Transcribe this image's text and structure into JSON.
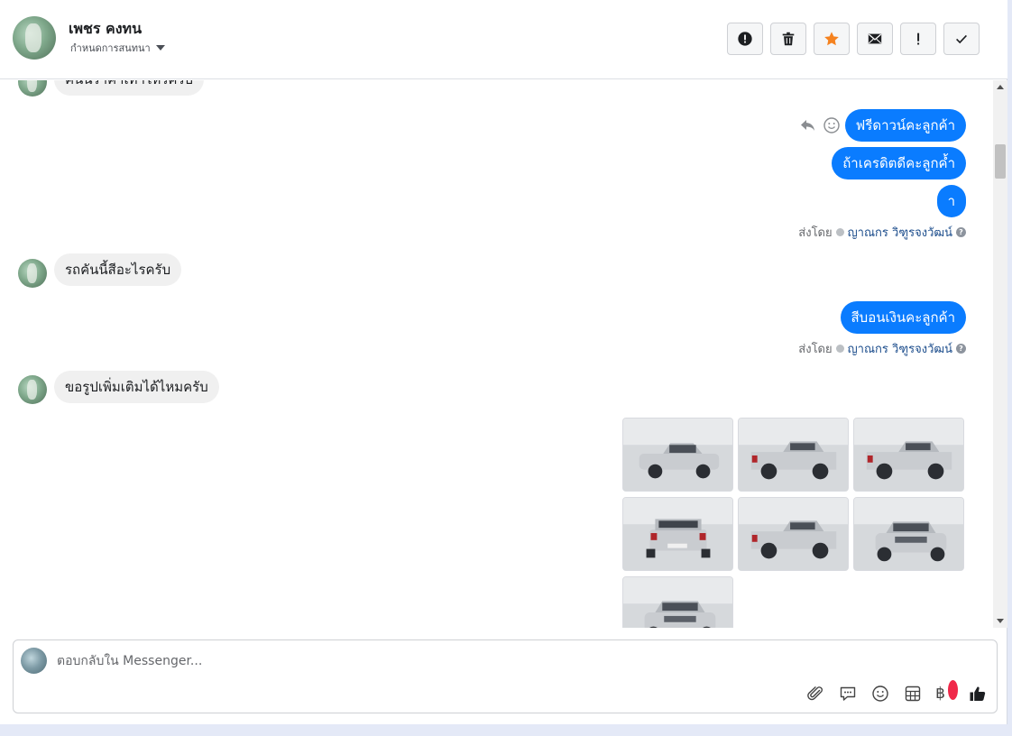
{
  "header": {
    "contact_name": "เพชร คงทน",
    "assign_label": "กำหนดการสนทนา",
    "tools": [
      {
        "name": "spam-button",
        "icon": "alert-circle-icon"
      },
      {
        "name": "delete-button",
        "icon": "trash-icon"
      },
      {
        "name": "star-button",
        "icon": "star-icon"
      },
      {
        "name": "mark-unread-button",
        "icon": "envelope-icon"
      },
      {
        "name": "follow-up-button",
        "icon": "exclamation-icon"
      },
      {
        "name": "done-button",
        "icon": "check-icon"
      }
    ],
    "accent_star_color": "#f5821f"
  },
  "thread": {
    "cut_message": "คันนี้ราคาเท่าไหร่ครับ",
    "messages_out_1": [
      "ฟรีดาวน์คะลูกค้า",
      "ถ้าเครดิตดีคะลูกค้ำ",
      "า"
    ],
    "sent_by_label": "ส่งโดย",
    "agent_name": "ญาณกร วิฑูรจงวัฒน์",
    "message_in_2": "รถคันนี้สีอะไรครับ",
    "message_out_2": "สีบอนเงินคะลูกค้า",
    "message_in_3": "ขอรูปเพิ่มเติมได้ไหมครับ",
    "photo_count": 7
  },
  "composer": {
    "placeholder": "ตอบกลับใน Messenger...",
    "currency_symbol": "฿",
    "tools": [
      "attach-icon",
      "saved-reply-icon",
      "emoji-icon",
      "table-icon",
      "payment-icon",
      "like-icon"
    ]
  },
  "colors": {
    "outgoing_bubble": "#0a7cff",
    "incoming_bubble": "#f0f0f0",
    "notification_dot": "#f02849"
  }
}
